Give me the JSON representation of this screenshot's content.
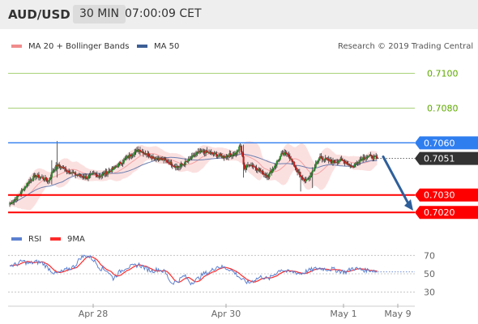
{
  "header": {
    "pair": "AUD/USD",
    "timeframe": "30 MIN",
    "time": "07:00:09 CET"
  },
  "legend": {
    "bb_label": "MA 20 + Bollinger Bands",
    "bb_color": "#f08c8c",
    "ma50_label": "MA 50",
    "ma50_color": "#3d5f94",
    "credit": "Research © 2019 Trading Central",
    "rsi_label": "RSI",
    "rsi_color": "#5b80d0",
    "ma9_label": "9MA",
    "ma9_color": "#ff2a2a"
  },
  "chart_data": [
    {
      "type": "candlestick",
      "title": "AUD/USD 30 MIN",
      "ylim": [
        7014.5,
        7110
      ],
      "price_scale": "value ×0.0001",
      "current_price": "0.7051",
      "levels": [
        {
          "label": "0.7100",
          "value": 7100,
          "color": "#5ea800",
          "kind": "target"
        },
        {
          "label": "0.7080",
          "value": 7080,
          "color": "#5ea800",
          "kind": "target"
        },
        {
          "label": "0.7060",
          "value": 7060,
          "color": "#2f7ef0",
          "kind": "pivot"
        },
        {
          "label": "0.7030",
          "value": 7030,
          "color": "#ff0000",
          "kind": "support"
        },
        {
          "label": "0.7020",
          "value": 7020,
          "color": "#ff0000",
          "kind": "support"
        }
      ],
      "x_ticks": [
        "Apr 28",
        "Apr 30",
        "May 1",
        "May 9"
      ],
      "arrow": {
        "from": 7052,
        "to": 7021,
        "direction": "down",
        "color": "#2e5f9a"
      },
      "waypoints": [
        [
          0,
          7025
        ],
        [
          6,
          7028
        ],
        [
          12,
          7033
        ],
        [
          18,
          7038
        ],
        [
          24,
          7041
        ],
        [
          30,
          7040
        ],
        [
          36,
          7038
        ],
        [
          40,
          7044
        ],
        [
          44,
          7047
        ],
        [
          48,
          7046
        ],
        [
          54,
          7044
        ],
        [
          60,
          7042
        ],
        [
          66,
          7041
        ],
        [
          72,
          7040
        ],
        [
          78,
          7042
        ],
        [
          84,
          7041
        ],
        [
          90,
          7043
        ],
        [
          96,
          7045
        ],
        [
          102,
          7048
        ],
        [
          108,
          7051
        ],
        [
          114,
          7054
        ],
        [
          120,
          7056
        ],
        [
          126,
          7054
        ],
        [
          132,
          7052
        ],
        [
          138,
          7051
        ],
        [
          144,
          7050
        ],
        [
          150,
          7048
        ],
        [
          156,
          7046
        ],
        [
          162,
          7048
        ],
        [
          168,
          7051
        ],
        [
          174,
          7054
        ],
        [
          180,
          7055
        ],
        [
          186,
          7054
        ],
        [
          192,
          7053
        ],
        [
          198,
          7052
        ],
        [
          204,
          7053
        ],
        [
          210,
          7054
        ],
        [
          214,
          7058
        ],
        [
          218,
          7045
        ],
        [
          222,
          7048
        ],
        [
          228,
          7046
        ],
        [
          234,
          7043
        ],
        [
          240,
          7041
        ],
        [
          246,
          7047
        ],
        [
          252,
          7053
        ],
        [
          258,
          7054
        ],
        [
          262,
          7049
        ],
        [
          266,
          7045
        ],
        [
          270,
          7040
        ],
        [
          276,
          7038
        ],
        [
          282,
          7045
        ],
        [
          288,
          7052
        ],
        [
          294,
          7050
        ],
        [
          300,
          7049
        ],
        [
          306,
          7050
        ],
        [
          312,
          7049
        ],
        [
          318,
          7046
        ],
        [
          324,
          7050
        ],
        [
          330,
          7052
        ],
        [
          336,
          7052
        ],
        [
          341,
          7051
        ]
      ]
    },
    {
      "type": "line",
      "title": "RSI",
      "ylim": [
        20,
        80
      ],
      "y_ticks": [
        70,
        50,
        30
      ],
      "rsi_waypoints": [
        [
          0,
          59
        ],
        [
          6,
          60
        ],
        [
          12,
          64
        ],
        [
          18,
          61
        ],
        [
          24,
          63
        ],
        [
          30,
          62
        ],
        [
          36,
          56
        ],
        [
          42,
          50
        ],
        [
          48,
          52
        ],
        [
          54,
          55
        ],
        [
          60,
          58
        ],
        [
          66,
          68
        ],
        [
          72,
          70
        ],
        [
          78,
          65
        ],
        [
          84,
          56
        ],
        [
          90,
          54
        ],
        [
          96,
          45
        ],
        [
          102,
          52
        ],
        [
          108,
          57
        ],
        [
          114,
          58
        ],
        [
          120,
          60
        ],
        [
          126,
          56
        ],
        [
          132,
          53
        ],
        [
          138,
          55
        ],
        [
          144,
          52
        ],
        [
          150,
          40
        ],
        [
          156,
          42
        ],
        [
          162,
          48
        ],
        [
          168,
          40
        ],
        [
          174,
          44
        ],
        [
          180,
          50
        ],
        [
          186,
          52
        ],
        [
          192,
          58
        ],
        [
          198,
          57
        ],
        [
          204,
          55
        ],
        [
          210,
          50
        ],
        [
          216,
          43
        ],
        [
          222,
          40
        ],
        [
          228,
          44
        ],
        [
          234,
          47
        ],
        [
          240,
          44
        ],
        [
          246,
          50
        ],
        [
          252,
          55
        ],
        [
          258,
          52
        ],
        [
          264,
          52
        ],
        [
          270,
          50
        ],
        [
          276,
          53
        ],
        [
          282,
          55
        ],
        [
          288,
          56
        ],
        [
          294,
          55
        ],
        [
          300,
          55
        ],
        [
          306,
          53
        ],
        [
          312,
          52
        ],
        [
          318,
          56
        ],
        [
          324,
          55
        ],
        [
          330,
          54
        ],
        [
          336,
          54
        ],
        [
          341,
          52
        ]
      ]
    }
  ]
}
